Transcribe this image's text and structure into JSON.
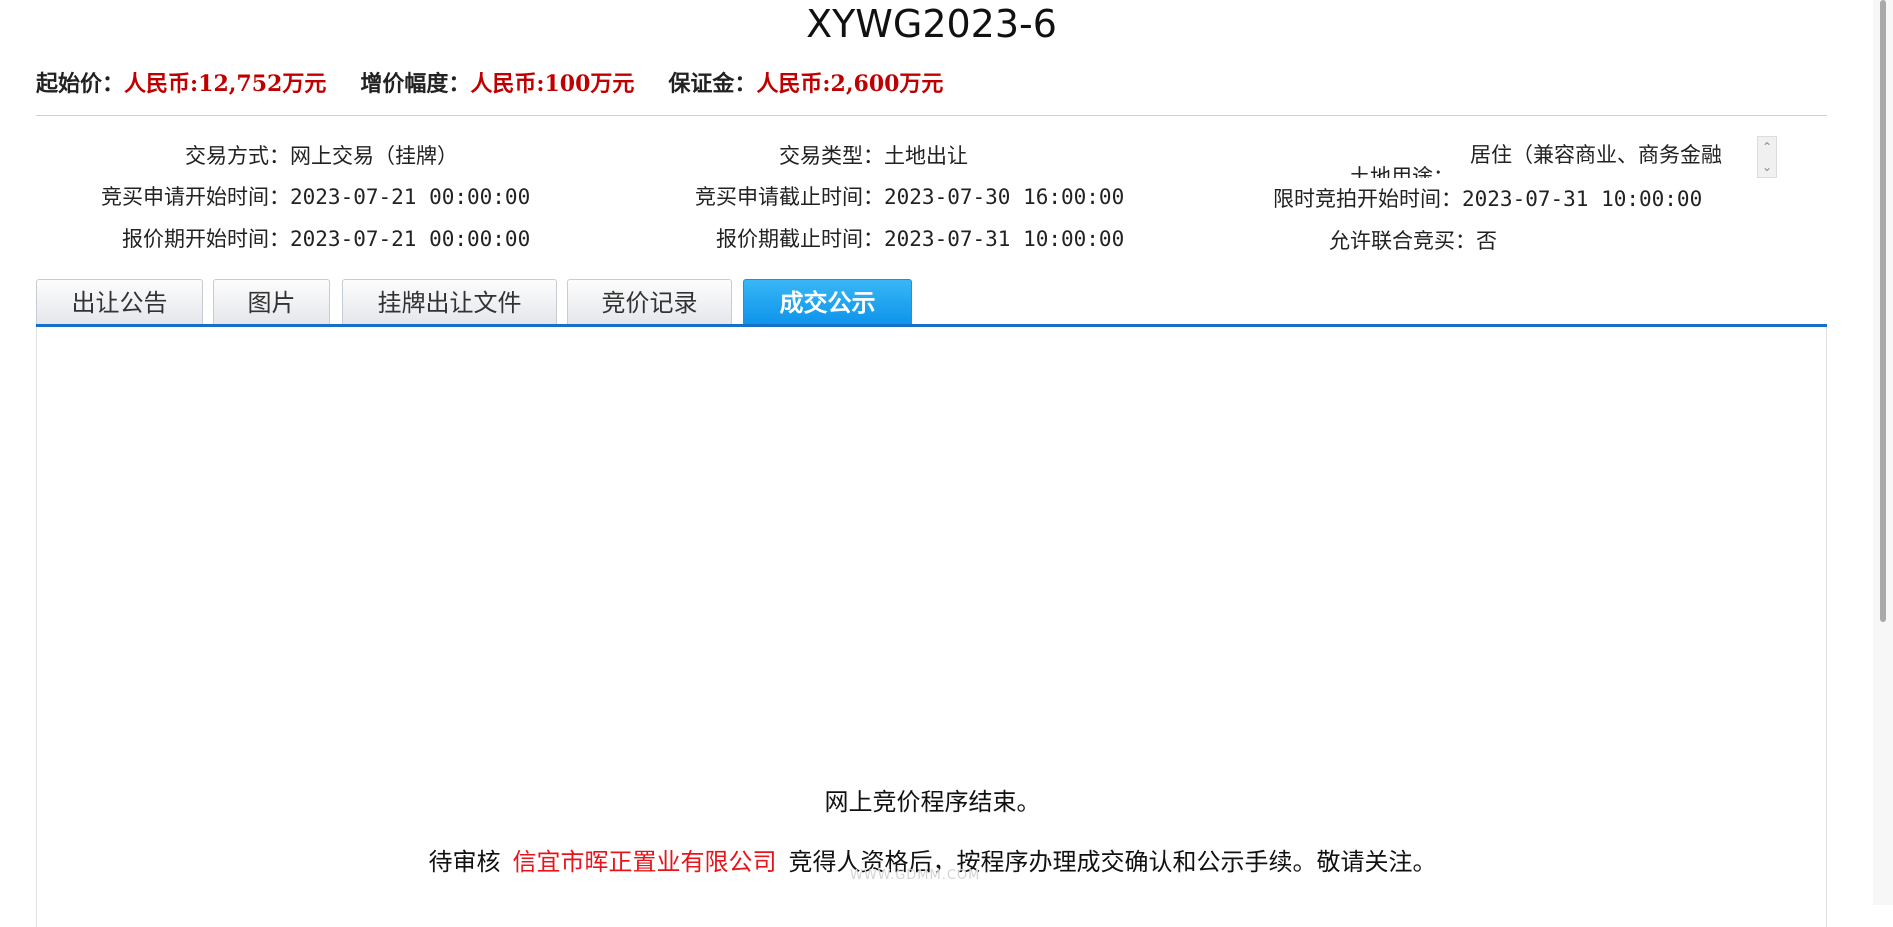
{
  "header": {
    "title": "XYWG2023-6"
  },
  "prices": [
    {
      "label": "起始价：",
      "value": "人民币:12,752万元"
    },
    {
      "label": "增价幅度：",
      "value": "人民币:100万元"
    },
    {
      "label": "保证金：",
      "value": "人民币:2,600万元"
    }
  ],
  "info": {
    "trade_method": {
      "label": "交易方式：",
      "value": "网上交易（挂牌）"
    },
    "trade_type": {
      "label": "交易类型：",
      "value": "土地出让"
    },
    "land_use": {
      "label": "土地用途：",
      "value": "居住（兼容商业、商务金融"
    },
    "apply_start": {
      "label": "竞买申请开始时间：",
      "value": "2023-07-21 00:00:00"
    },
    "apply_end": {
      "label": "竞买申请截止时间：",
      "value": "2023-07-30 16:00:00"
    },
    "auction_start": {
      "label": "限时竞拍开始时间：",
      "value": "2023-07-31 10:00:00"
    },
    "quote_start": {
      "label": "报价期开始时间：",
      "value": "2023-07-21 00:00:00"
    },
    "quote_end": {
      "label": "报价期截止时间：",
      "value": "2023-07-31 10:00:00"
    },
    "joint_bid": {
      "label": "允许联合竞买：",
      "value": "否"
    }
  },
  "tabs": [
    {
      "label": "出让公告",
      "active": false
    },
    {
      "label": "图片",
      "active": false
    },
    {
      "label": "挂牌出让文件",
      "active": false
    },
    {
      "label": "竞价记录",
      "active": false
    },
    {
      "label": "成交公示",
      "active": true
    }
  ],
  "result": {
    "line1": "网上竞价程序结束。",
    "prefix": "待审核",
    "company": "信宜市晖正置业有限公司",
    "suffix": "竞得人资格后，按程序办理成交确认和公示手续。敬请关注。"
  },
  "watermark": "WWW.GDMM.COM",
  "colors": {
    "accent": "#1570c9",
    "highlight": "#c00000",
    "company": "#e8141a"
  }
}
